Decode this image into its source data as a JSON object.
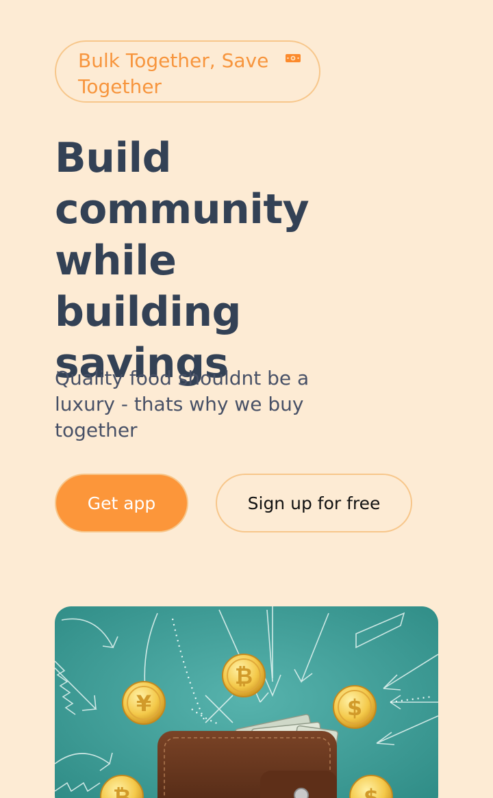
{
  "tagline": {
    "text": "Bulk Together, Save Together",
    "icon": "money-bill-icon",
    "color": "#f7953d"
  },
  "hero": {
    "headline": "Build community while building savings",
    "subtext": "Quality food shouldnt be a luxury - thats why we buy together"
  },
  "buttons": {
    "get_app": "Get app",
    "sign_up": "Sign up for free"
  },
  "image": {
    "subject": "wallet-with-coins-illustration"
  },
  "colors": {
    "background": "#fdebd4",
    "accent": "#fc963a",
    "heading": "#334155",
    "border": "#f7c68a",
    "image_background": "#3d9c96"
  }
}
